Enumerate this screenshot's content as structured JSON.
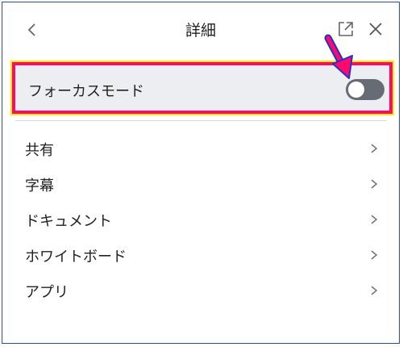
{
  "header": {
    "title": "詳細",
    "back_icon": "chevron-left-icon",
    "popout_icon": "external-link-icon",
    "close_icon": "close-icon"
  },
  "focus_mode": {
    "label": "フォーカスモード",
    "toggle_on": false
  },
  "menu": {
    "items": [
      {
        "label": "共有"
      },
      {
        "label": "字幕"
      },
      {
        "label": "ドキュメント"
      },
      {
        "label": "ホワイトボード"
      },
      {
        "label": "アプリ"
      }
    ],
    "chevron_icon": "chevron-right-icon"
  },
  "colors": {
    "highlight_border": "#ff0a6c",
    "highlight_outline": "#ffee00",
    "arrow": "#ff0a6c",
    "toggle_off": "#676b73",
    "row_bg": "#eceef1"
  }
}
